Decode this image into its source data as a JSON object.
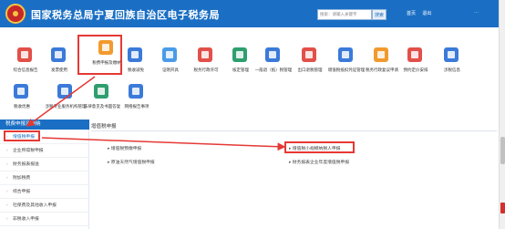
{
  "header": {
    "site_title": "国家税务总局宁夏回族自治区电子税务局",
    "search_placeholder": "搜索：请输入关键字",
    "search_button": "搜索",
    "links": [
      "首页",
      "退出"
    ],
    "more": "⋯"
  },
  "services": [
    {
      "label": "综合信息报告",
      "color": "#e2504a"
    },
    {
      "label": "发票使用",
      "color": "#3b7ad9"
    },
    {
      "label": "税费申报及缴纳",
      "color": "#f29a2e"
    },
    {
      "label": "税收减免",
      "color": "#3b7ad9"
    },
    {
      "label": "证明开具",
      "color": "#4a9be8"
    },
    {
      "label": "税务行政许可",
      "color": "#e2504a"
    },
    {
      "label": "核定管理",
      "color": "#2f9e6e"
    },
    {
      "label": "一般退（抵）税管理",
      "color": "#3b7ad9"
    },
    {
      "label": "出口退税管理",
      "color": "#e2504a"
    },
    {
      "label": "增值税抵扣凭证管理",
      "color": "#3b7ad9"
    },
    {
      "label": "税务行政复议申请",
      "color": "#f29a2e"
    },
    {
      "label": "预约定价安排",
      "color": "#e2504a"
    },
    {
      "label": "涉税信息",
      "color": "#3b7ad9"
    },
    {
      "label": "税收优惠",
      "color": "#3b7ad9"
    },
    {
      "label": "涉税专业服务机构管理",
      "color": "#3b7ad9"
    },
    {
      "label": "法律意见及书面答复",
      "color": "#2f9e6e"
    },
    {
      "label": "网络报告事项",
      "color": "#3b7ad9"
    }
  ],
  "sidebar": {
    "title": "税费申报及缴纳",
    "items": [
      "增值税申报",
      "企业所得税申报",
      "财务报表报送",
      "附加税费",
      "综合申报",
      "社保费及其他收入申报",
      "非税收入申报"
    ]
  },
  "main": {
    "section_title": "增值税申报",
    "reports_left": [
      "增值税预缴申报",
      "原油天然气增值税申报"
    ],
    "reports_right": [
      "增值税小规模纳税人申报",
      "财务报表企业年度增值税申报"
    ]
  }
}
